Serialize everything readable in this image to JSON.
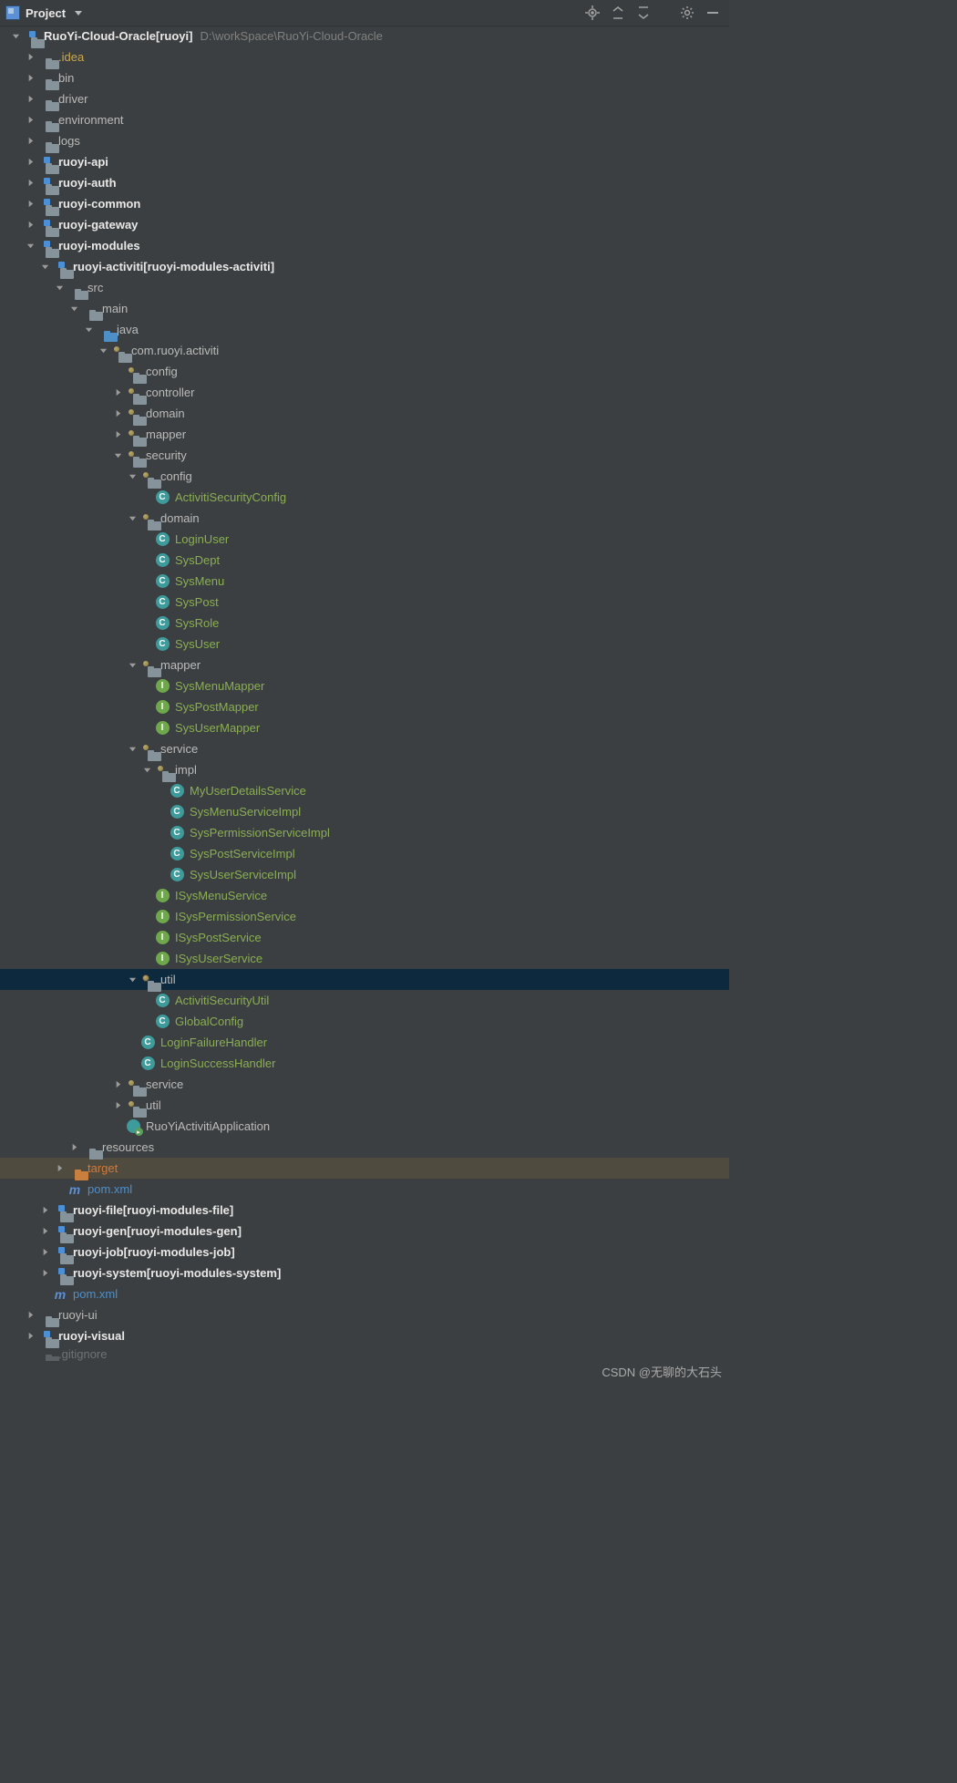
{
  "toolbar": {
    "title": "Project",
    "icons": {
      "target": "target-icon",
      "expand": "expand-all-icon",
      "collapse": "collapse-all-icon",
      "gear": "gear-icon",
      "hide": "hide-icon"
    }
  },
  "watermark": "CSDN @无聊的大石头",
  "nodes": [
    {
      "d": 1,
      "a": "down",
      "i": "module",
      "t": "RuoYi-Cloud-Oracle",
      "b": 1,
      "suf": " [ruoyi]",
      "path": "D:\\workSpace\\RuoYi-Cloud-Oracle"
    },
    {
      "d": 2,
      "a": "right",
      "i": "folder",
      "t": ".idea",
      "cls": "yellow"
    },
    {
      "d": 2,
      "a": "right",
      "i": "folder",
      "t": "bin"
    },
    {
      "d": 2,
      "a": "right",
      "i": "folder",
      "t": "driver"
    },
    {
      "d": 2,
      "a": "right",
      "i": "folder",
      "t": "environment"
    },
    {
      "d": 2,
      "a": "right",
      "i": "folder",
      "t": "logs"
    },
    {
      "d": 2,
      "a": "right",
      "i": "module",
      "t": "ruoyi-api",
      "b": 1
    },
    {
      "d": 2,
      "a": "right",
      "i": "module",
      "t": "ruoyi-auth",
      "b": 1
    },
    {
      "d": 2,
      "a": "right",
      "i": "module",
      "t": "ruoyi-common",
      "b": 1
    },
    {
      "d": 2,
      "a": "right",
      "i": "module",
      "t": "ruoyi-gateway",
      "b": 1
    },
    {
      "d": 2,
      "a": "down",
      "i": "module",
      "t": "ruoyi-modules",
      "b": 1
    },
    {
      "d": 3,
      "a": "down",
      "i": "module",
      "t": "ruoyi-activiti",
      "b": 1,
      "suf": " [ruoyi-modules-activiti]"
    },
    {
      "d": 4,
      "a": "down",
      "i": "folder",
      "t": "src"
    },
    {
      "d": 5,
      "a": "down",
      "i": "folder",
      "t": "main"
    },
    {
      "d": 6,
      "a": "down",
      "i": "src",
      "t": "java"
    },
    {
      "d": 7,
      "a": "down",
      "i": "pkg",
      "t": "com.ruoyi.activiti"
    },
    {
      "d": 8,
      "a": "",
      "i": "pkg",
      "t": "config"
    },
    {
      "d": 8,
      "a": "right",
      "i": "pkg",
      "t": "controller"
    },
    {
      "d": 8,
      "a": "right",
      "i": "pkg",
      "t": "domain"
    },
    {
      "d": 8,
      "a": "right",
      "i": "pkg",
      "t": "mapper"
    },
    {
      "d": 8,
      "a": "down",
      "i": "pkg",
      "t": "security"
    },
    {
      "d": 9,
      "a": "down",
      "i": "pkg",
      "t": "config"
    },
    {
      "d": 10,
      "a": "",
      "i": "c",
      "t": "ActivitiSecurityConfig",
      "cls": "green"
    },
    {
      "d": 9,
      "a": "down",
      "i": "pkg",
      "t": "domain"
    },
    {
      "d": 10,
      "a": "",
      "i": "c",
      "t": "LoginUser",
      "cls": "green"
    },
    {
      "d": 10,
      "a": "",
      "i": "c",
      "t": "SysDept",
      "cls": "green"
    },
    {
      "d": 10,
      "a": "",
      "i": "c",
      "t": "SysMenu",
      "cls": "green"
    },
    {
      "d": 10,
      "a": "",
      "i": "c",
      "t": "SysPost",
      "cls": "green"
    },
    {
      "d": 10,
      "a": "",
      "i": "c",
      "t": "SysRole",
      "cls": "green"
    },
    {
      "d": 10,
      "a": "",
      "i": "c",
      "t": "SysUser",
      "cls": "green"
    },
    {
      "d": 9,
      "a": "down",
      "i": "pkg",
      "t": "mapper"
    },
    {
      "d": 10,
      "a": "",
      "i": "i",
      "t": "SysMenuMapper",
      "cls": "green"
    },
    {
      "d": 10,
      "a": "",
      "i": "i",
      "t": "SysPostMapper",
      "cls": "green"
    },
    {
      "d": 10,
      "a": "",
      "i": "i",
      "t": "SysUserMapper",
      "cls": "green"
    },
    {
      "d": 9,
      "a": "down",
      "i": "pkg",
      "t": "service"
    },
    {
      "d": 10,
      "a": "down",
      "i": "pkg",
      "t": "impl"
    },
    {
      "d": 11,
      "a": "",
      "i": "c",
      "t": "MyUserDetailsService",
      "cls": "green"
    },
    {
      "d": 11,
      "a": "",
      "i": "c",
      "t": "SysMenuServiceImpl",
      "cls": "green"
    },
    {
      "d": 11,
      "a": "",
      "i": "c",
      "t": "SysPermissionServiceImpl",
      "cls": "green"
    },
    {
      "d": 11,
      "a": "",
      "i": "c",
      "t": "SysPostServiceImpl",
      "cls": "green"
    },
    {
      "d": 11,
      "a": "",
      "i": "c",
      "t": "SysUserServiceImpl",
      "cls": "green"
    },
    {
      "d": 10,
      "a": "",
      "i": "i",
      "t": "ISysMenuService",
      "cls": "green"
    },
    {
      "d": 10,
      "a": "",
      "i": "i",
      "t": "ISysPermissionService",
      "cls": "green"
    },
    {
      "d": 10,
      "a": "",
      "i": "i",
      "t": "ISysPostService",
      "cls": "green"
    },
    {
      "d": 10,
      "a": "",
      "i": "i",
      "t": "ISysUserService",
      "cls": "green"
    },
    {
      "d": 9,
      "a": "down",
      "i": "pkg",
      "t": "util",
      "sel": 1
    },
    {
      "d": 10,
      "a": "",
      "i": "c",
      "t": "ActivitiSecurityUtil",
      "cls": "green"
    },
    {
      "d": 10,
      "a": "",
      "i": "c",
      "t": "GlobalConfig",
      "cls": "green"
    },
    {
      "d": 9,
      "a": "",
      "i": "c",
      "t": "LoginFailureHandler",
      "cls": "green"
    },
    {
      "d": 9,
      "a": "",
      "i": "c",
      "t": "LoginSuccessHandler",
      "cls": "green"
    },
    {
      "d": 8,
      "a": "right",
      "i": "pkg",
      "t": "service"
    },
    {
      "d": 8,
      "a": "right",
      "i": "pkg",
      "t": "util"
    },
    {
      "d": 8,
      "a": "",
      "i": "app",
      "t": "RuoYiActivitiApplication"
    },
    {
      "d": 5,
      "a": "right",
      "i": "folder",
      "t": "resources"
    },
    {
      "d": 4,
      "a": "right",
      "i": "folder-orange",
      "t": "target",
      "cls": "orange",
      "sel": 2
    },
    {
      "d": 4,
      "a": "",
      "i": "maven",
      "t": "pom.xml",
      "cls": "blue"
    },
    {
      "d": 3,
      "a": "right",
      "i": "module",
      "t": "ruoyi-file",
      "b": 1,
      "suf": " [ruoyi-modules-file]"
    },
    {
      "d": 3,
      "a": "right",
      "i": "module",
      "t": "ruoyi-gen",
      "b": 1,
      "suf": " [ruoyi-modules-gen]"
    },
    {
      "d": 3,
      "a": "right",
      "i": "module",
      "t": "ruoyi-job",
      "b": 1,
      "suf": " [ruoyi-modules-job]"
    },
    {
      "d": 3,
      "a": "right",
      "i": "module",
      "t": "ruoyi-system",
      "b": 1,
      "suf": " [ruoyi-modules-system]"
    },
    {
      "d": 3,
      "a": "",
      "i": "maven",
      "t": "pom.xml",
      "cls": "blue"
    },
    {
      "d": 2,
      "a": "right",
      "i": "folder",
      "t": "ruoyi-ui"
    },
    {
      "d": 2,
      "a": "right",
      "i": "module",
      "t": "ruoyi-visual",
      "b": 1
    },
    {
      "d": 2,
      "a": "",
      "i": "folder",
      "t": ".gitignore",
      "cut": 1
    }
  ]
}
